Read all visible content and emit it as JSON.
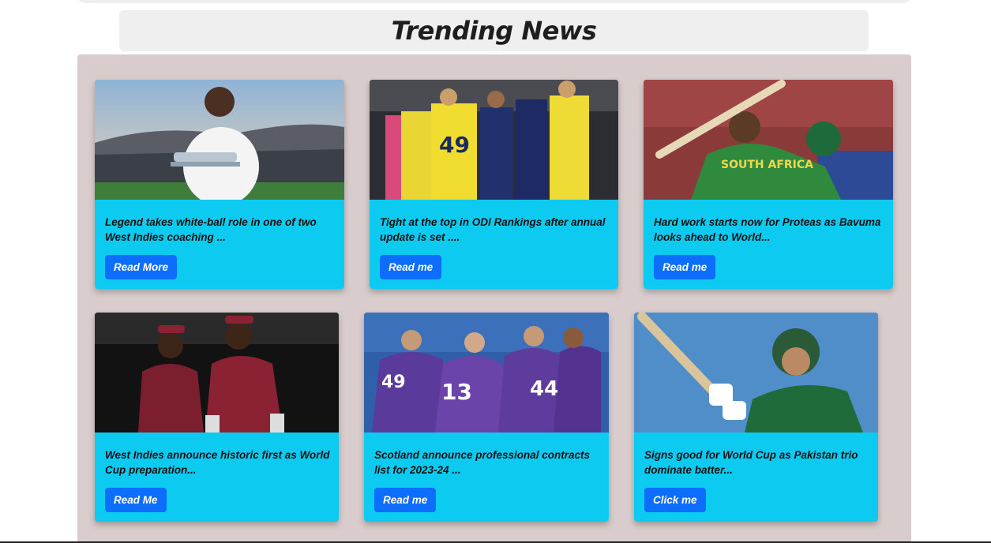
{
  "page": {
    "title": "Trending News"
  },
  "cards": [
    {
      "text": "Legend takes white-ball role in one of two West Indies coaching ...",
      "button": "Read More",
      "image": "player-holding-trophy-stadium"
    },
    {
      "text": "Tight at the top in ODI Rankings after annual update is set ....",
      "button": "Read me",
      "image": "australia-india-players-handshake"
    },
    {
      "text": "Hard work starts now for Proteas as Bavuma looks ahead to World...",
      "button": "Read me",
      "image": "south-africa-batter-celebrating"
    },
    {
      "text": "West Indies announce historic first as World Cup preparation...",
      "button": "Read Me",
      "image": "west-indies-fielders"
    },
    {
      "text": "Scotland announce professional contracts list for 2023-24 ...",
      "button": "Read me",
      "image": "scotland-team-huddle"
    },
    {
      "text": "Signs good for World Cup as Pakistan trio dominate batter...",
      "button": "Click me",
      "image": "pakistan-batter-shot"
    }
  ],
  "colors": {
    "panel": "#d8cccc",
    "card": "#0dcaf0",
    "button": "#0d6efd"
  }
}
